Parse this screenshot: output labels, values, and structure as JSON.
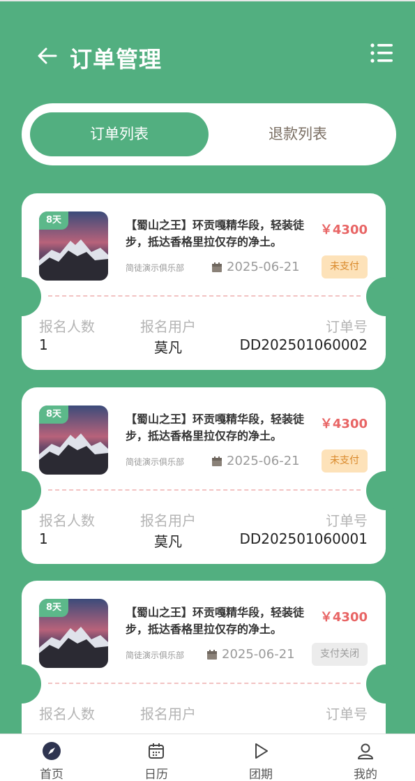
{
  "header": {
    "title": "订单管理"
  },
  "tabs": [
    {
      "label": "订单列表",
      "active": true
    },
    {
      "label": "退款列表",
      "active": false
    }
  ],
  "colors": {
    "primary": "#52af80",
    "price": "#e86565",
    "unpaid_bg": "#fde2b9",
    "closed_bg": "#ececec"
  },
  "orders": [
    {
      "days": "8天",
      "title": "【蜀山之王】环贡嘎精华段，轻装徒步，抵达香格里拉仅存的净土。",
      "price": "￥4300",
      "club": "简徒演示俱乐部",
      "date": "2025-06-21",
      "status": "未支付",
      "labels": {
        "count": "报名人数",
        "user": "报名用户",
        "order_no": "订单号"
      },
      "count": "1",
      "user": "莫凡",
      "order_no": "DD202501060002"
    },
    {
      "days": "8天",
      "title": "【蜀山之王】环贡嘎精华段，轻装徒步，抵达香格里拉仅存的净土。",
      "price": "￥4300",
      "club": "简徒演示俱乐部",
      "date": "2025-06-21",
      "status": "未支付",
      "labels": {
        "count": "报名人数",
        "user": "报名用户",
        "order_no": "订单号"
      },
      "count": "1",
      "user": "莫凡",
      "order_no": "DD202501060001"
    },
    {
      "days": "8天",
      "title": "【蜀山之王】环贡嘎精华段，轻装徒步，抵达香格里拉仅存的净土。",
      "price": "￥4300",
      "club": "简徒演示俱乐部",
      "date": "2025-06-21",
      "status": "支付关闭",
      "labels": {
        "count": "报名人数",
        "user": "报名用户",
        "order_no": "订单号"
      }
    }
  ],
  "tabbar": [
    {
      "label": "首页",
      "icon": "compass-icon"
    },
    {
      "label": "日历",
      "icon": "calendar-icon"
    },
    {
      "label": "团期",
      "icon": "play-icon"
    },
    {
      "label": "我的",
      "icon": "user-icon"
    }
  ]
}
